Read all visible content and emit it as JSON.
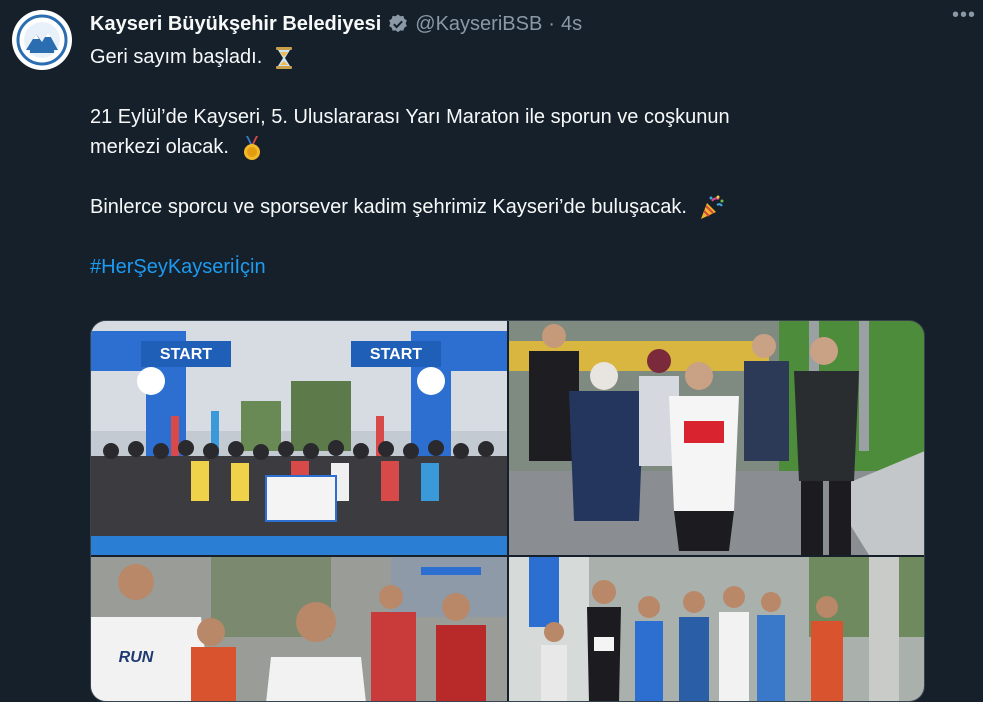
{
  "tweet": {
    "author_name": "Kayseri Büyükşehir Belediyesi",
    "handle": "@KayseriBSB",
    "separator": "·",
    "time": "4s",
    "more_label": "•••",
    "lines": {
      "line1": "Geri sayım başladı.",
      "line2": "21 Eylül’de Kayseri, 5. Uluslararası Yarı Maraton ile sporun ve coşkunun",
      "line3": "merkezi olacak.",
      "line4": "Binlerce sporcu ve sporsever kadim şehrimiz Kayseri’de buluşacak."
    },
    "hashtag": "#HerŞeyKayseriİçin"
  },
  "media": {
    "photo1": {
      "arch_left": "START",
      "arch_right": "START"
    },
    "photo3": {
      "shirt_text": "RUN"
    }
  },
  "colors": {
    "background": "#15202b",
    "text": "#f7f9f9",
    "secondary_text": "#8b98a5",
    "link": "#1d9bf0",
    "border": "#38444d"
  },
  "icons": {
    "verified": "verified-badge-icon",
    "hourglass": "hourglass-icon",
    "medal": "medal-icon",
    "party": "party-popper-icon",
    "more": "more-options-icon"
  }
}
